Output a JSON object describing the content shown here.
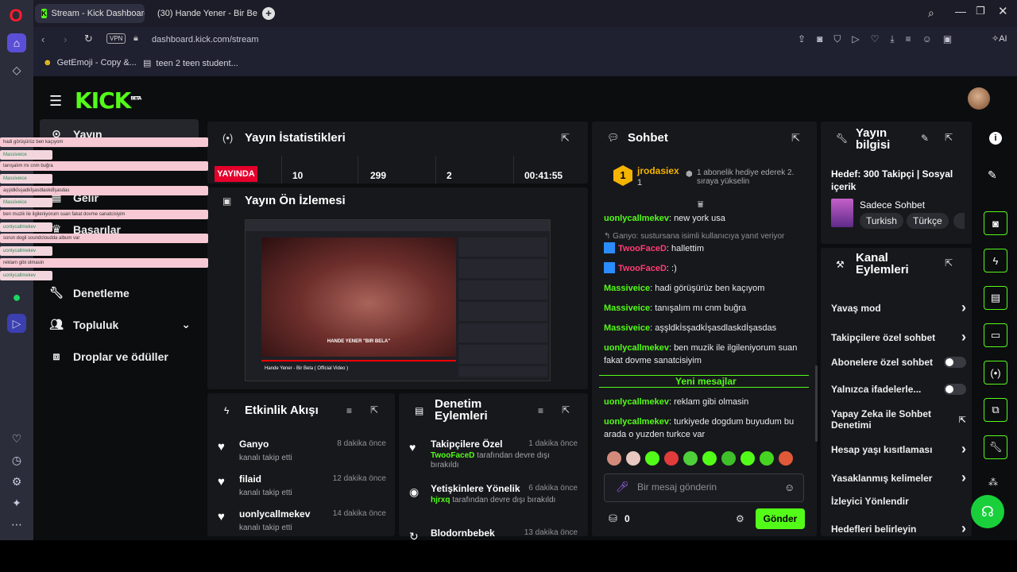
{
  "browser": {
    "tabs": [
      {
        "label": "Stream - Kick Dashboard",
        "active": true
      },
      {
        "label": "(30) Hande Yener - Bir Bela",
        "active": false
      }
    ],
    "vpn_label": "VPN",
    "url": "dashboard.kick.com/stream",
    "ai_label": "AI",
    "bookmarks": [
      "GetEmoji - Copy &...",
      "teen 2 teen student..."
    ]
  },
  "kick": {
    "logo": "KICK",
    "logo_sup": "BETA",
    "nav": {
      "items": [
        "Yayın",
        "Gelir",
        "Başarılar",
        "Denetleme",
        "Topluluk",
        "Droplar ve ödüller"
      ]
    }
  },
  "stats": {
    "title": "Yayın İstatistikleri",
    "live_badge": "YAYINDA",
    "viewers": "10",
    "followers": "299",
    "subs": "2",
    "duration": "00:41:55"
  },
  "preview": {
    "title": "Yayın Ön İzlemesi",
    "video_caption": "HANDE YENER      \"BIR BELA\"",
    "video_title": "Hande Yener - Bir Bela ( Official Video )"
  },
  "activity": {
    "title": "Etkinlik Akışı",
    "items": [
      {
        "name": "Ganyo",
        "sub": "kanalı takip etti",
        "time": "8 dakika önce"
      },
      {
        "name": "filaid",
        "sub": "kanalı takip etti",
        "time": "12 dakika önce"
      },
      {
        "name": "uonlycallmekev",
        "sub": "kanalı takip etti",
        "time": "14 dakika önce"
      }
    ]
  },
  "moderation": {
    "title": "Denetim Eylemleri",
    "items": [
      {
        "name": "Takipçilere Özel",
        "who": "TwooFaceD",
        "sub": "tarafından devre dışı bırakıldı",
        "time": "1 dakika önce"
      },
      {
        "name": "Yetişkinlere Yönelik",
        "who": "hjrxq",
        "sub": "tarafından devre dışı bırakıldı",
        "time": "6 dakika önce"
      },
      {
        "name": "Blodornbebek",
        "who": "",
        "sub": "",
        "time": "13 dakika önce"
      }
    ]
  },
  "chat": {
    "title": "Sohbet",
    "pinned": {
      "user": "jrodasiex",
      "count": "1",
      "text": "1 abonelik hediye ederek 2. sıraya yükselin"
    },
    "messages": [
      {
        "user": "uonlycallmekev",
        "color": "#53fc18",
        "text": "new york usa"
      },
      {
        "reply": "Ganyo: sustursana isimli kullanıcıya yanıt veriyor"
      },
      {
        "user": "TwooFaceD",
        "color": "#ff3c74",
        "text": "hallettim"
      },
      {
        "user": "TwooFaceD",
        "color": "#ff3c74",
        "text": ":)"
      },
      {
        "user": "Massiveice",
        "color": "#53fc18",
        "text": "hadi görüşürüz ben kaçıyom"
      },
      {
        "user": "Massiveice",
        "color": "#53fc18",
        "text": "tanışalım mı cnm buğra"
      },
      {
        "user": "Massiveice",
        "color": "#53fc18",
        "text": "aşşldkİsşadkİşasdlaskdİşasdas"
      },
      {
        "user": "uonlycallmekev",
        "color": "#53fc18",
        "text": "ben muzik ile ilgileniyorum suan fakat dovme sanatcisiyim"
      },
      {
        "user": "uonlycallmekev",
        "color": "#53fc18",
        "text": "reklam gibi olmasin"
      },
      {
        "user": "uonlycallmekev",
        "color": "#53fc18",
        "text": "turkiyede dogdum buyudum bu arada o yuzden turkce var"
      }
    ],
    "new_messages": "Yeni mesajlar",
    "placeholder": "Bir mesaj gönderin",
    "points": "0",
    "send": "Gönder"
  },
  "info": {
    "title": "Yayın bilgisi",
    "goal": "Hedef: 300 Takipçi | Sosyal içerik",
    "category": "Sadece Sohbet",
    "tags": [
      "Turkish",
      "Türkçe"
    ]
  },
  "channel_actions": {
    "title": "Kanal Eylemleri",
    "items": [
      {
        "label": "Yavaş mod",
        "control": "chevron"
      },
      {
        "label": "Takipçilere özel sohbet",
        "control": "chevron"
      },
      {
        "label": "Abonelere özel sohbet",
        "control": "toggle"
      },
      {
        "label": "Yalnızca ifadelerle...",
        "control": "toggle"
      },
      {
        "label": "Yapay Zeka ile Sohbet Denetimi",
        "control": "external"
      },
      {
        "label": "Hesap yaşı kısıtlaması",
        "control": "chevron"
      },
      {
        "label": "Yasaklanmış kelimeler",
        "control": "chevron"
      },
      {
        "label": "İzleyici Yönlendir",
        "control": "none"
      },
      {
        "label": "Hedefleri belirleyin",
        "control": "chevron"
      }
    ]
  },
  "overlay_chat": [
    "hadi görüşürüz ben kaçıyom",
    "Massiveice",
    "tanışalım mı cnm buğra",
    "Massiveice",
    "aşşldkİsşadkİşasdlaskdİşasdas",
    "Massiveice",
    "ben muzik ile ilgileniyorum suan fakat dovme sanatcisiyim",
    "uonlycallmekev",
    "sorun dogil soundcloudda album var",
    "uonlycallmekev",
    "reklam gibi olmasin",
    "uonlycallmekev"
  ],
  "colors": {
    "accent": "#53fc18",
    "live": "#e4002b",
    "bg": "#0c0d0f",
    "panel": "#17181c"
  }
}
